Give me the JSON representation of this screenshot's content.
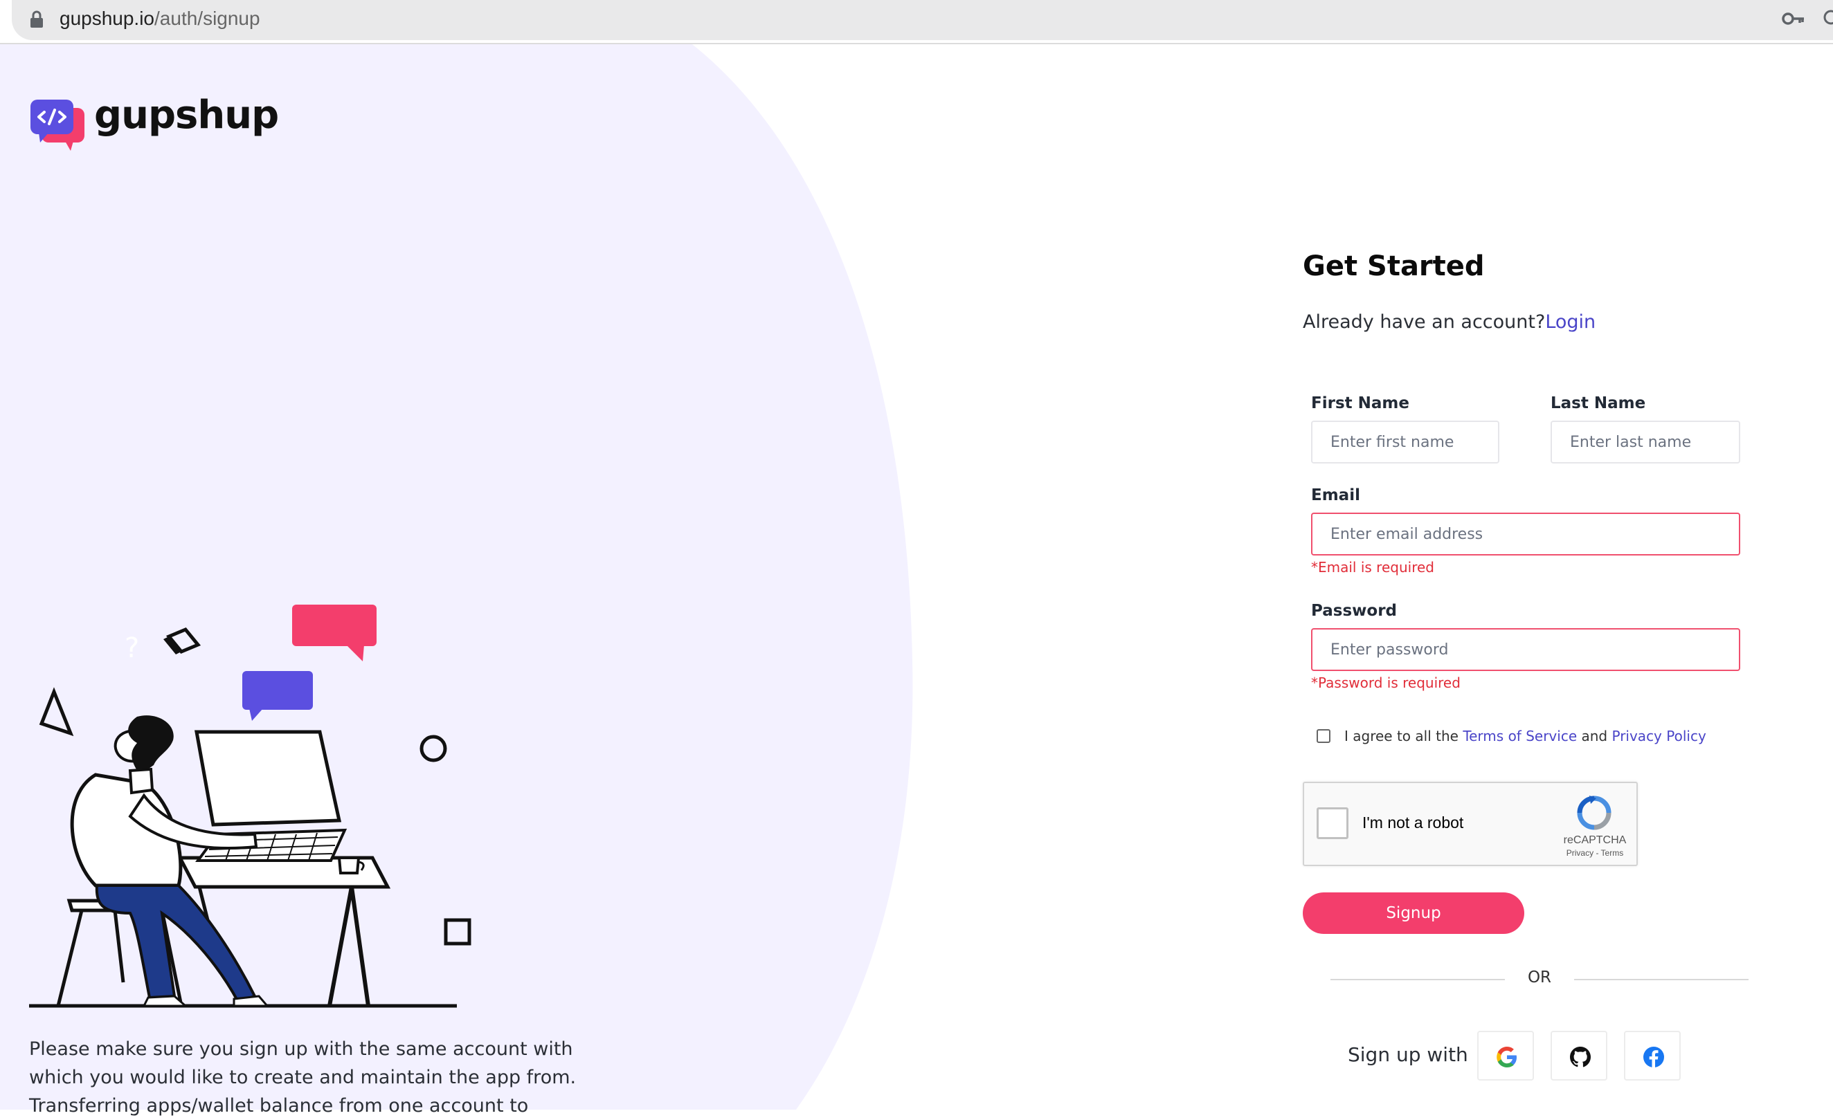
{
  "browser": {
    "url_host": "gupshup.io",
    "url_path": "/auth/signup"
  },
  "brand": {
    "name": "gupshup"
  },
  "left_panel": {
    "note": "Please make sure you sign up with the same account with which you would like to create and maintain the app from. Transferring apps/wallet balance from one account to"
  },
  "form": {
    "title": "Get Started",
    "already_text": "Already have an account?",
    "login_label": "Login",
    "first_name_label": "First Name",
    "first_name_placeholder": "Enter first name",
    "last_name_label": "Last Name",
    "last_name_placeholder": "Enter last name",
    "email_label": "Email",
    "email_placeholder": "Enter email address",
    "email_error": "*Email is required",
    "password_label": "Password",
    "password_placeholder": "Enter password",
    "password_error": "*Password is required",
    "agree_prefix": "I agree to all the",
    "terms_label": "Terms of Service",
    "agree_and": "and",
    "privacy_label": "Privacy Policy",
    "signup_label": "Signup",
    "or_label": "OR",
    "signup_with_label": "Sign up with"
  },
  "recaptcha": {
    "label": "I'm not a robot",
    "brand": "reCAPTCHA",
    "links": "Privacy - Terms"
  },
  "social": [
    {
      "name": "google-icon"
    },
    {
      "name": "github-icon"
    },
    {
      "name": "facebook-icon"
    }
  ],
  "colors": {
    "left_panel_bg": "#f3f1ff",
    "accent": "#f33e6c",
    "link": "#4a45c8",
    "error": "#e12d39",
    "brand_purple": "#5b4fe0",
    "brand_pink": "#f33e6c"
  }
}
